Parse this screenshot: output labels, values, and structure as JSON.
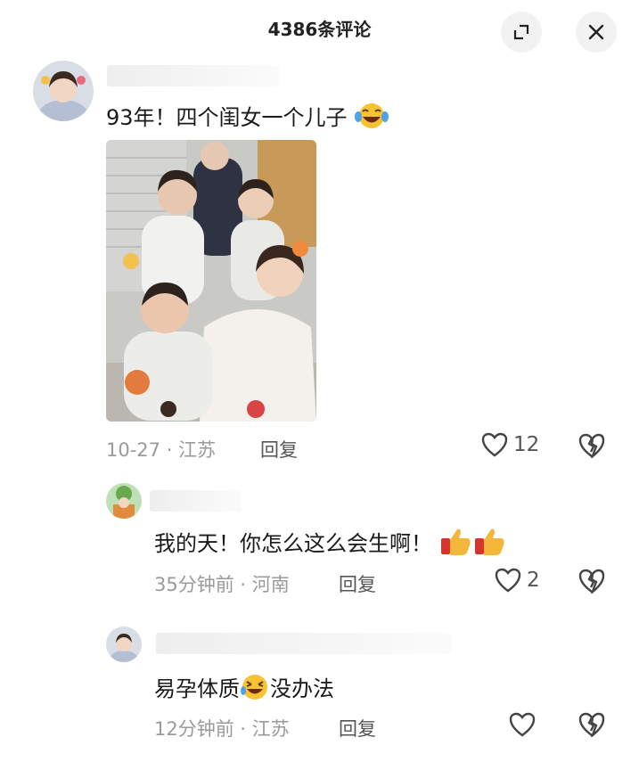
{
  "header": {
    "title": "4386条评论",
    "expand_icon": "expand-icon",
    "close_icon": "close-icon"
  },
  "comments": [
    {
      "text": "93年！四个闺女一个儿子",
      "emoji": "laughing-tears-emoji",
      "date": "10-27",
      "location": "江苏",
      "reply_label": "回复",
      "likes": "12",
      "has_photo": true
    },
    {
      "text": "我的天！你怎么这么会生啊！",
      "emoji": "thumbs-up-emoji",
      "date": "35分钟前",
      "location": "河南",
      "reply_label": "回复",
      "likes": "2"
    },
    {
      "text_before": "易孕体质",
      "emoji": "rolling-laughing-emoji",
      "text_after": "没办法",
      "date": "12分钟前",
      "location": "江苏",
      "reply_label": "回复",
      "likes": ""
    }
  ],
  "meta_separator": "·",
  "colors": {
    "meta": "#9a9a9a",
    "text": "#1a1a1a",
    "button_bg": "#f2f2f2"
  }
}
